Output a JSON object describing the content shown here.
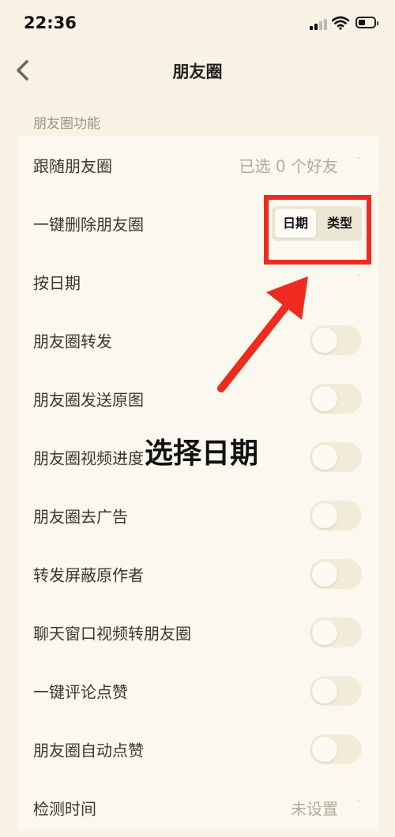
{
  "status_bar": {
    "time": "22:36"
  },
  "nav": {
    "title": "朋友圈"
  },
  "section": {
    "label": "朋友圈功能"
  },
  "rows": [
    {
      "label": "跟随朋友圈",
      "value": "已选 0 个好友"
    },
    {
      "label": "一键删除朋友圈",
      "segments": [
        "日期",
        "类型"
      ]
    },
    {
      "label": "按日期"
    },
    {
      "label": "朋友圈转发",
      "toggle": false
    },
    {
      "label": "朋友圈发送原图",
      "toggle": false
    },
    {
      "label": "朋友圈视频进度",
      "toggle": false
    },
    {
      "label": "朋友圈去广告",
      "toggle": false
    },
    {
      "label": "转发屏蔽原作者",
      "toggle": false
    },
    {
      "label": "聊天窗口视频转朋友圈",
      "toggle": false
    },
    {
      "label": "一键评论点赞",
      "toggle": false
    },
    {
      "label": "朋友圈自动点赞",
      "toggle": false
    },
    {
      "label": "检测时间",
      "value": "未设置"
    }
  ],
  "annotation": {
    "text": "选择日期",
    "color": "#ee2b1e"
  },
  "colors": {
    "background": "#f7f2e3",
    "annotation_red": "#ee2b1e"
  }
}
